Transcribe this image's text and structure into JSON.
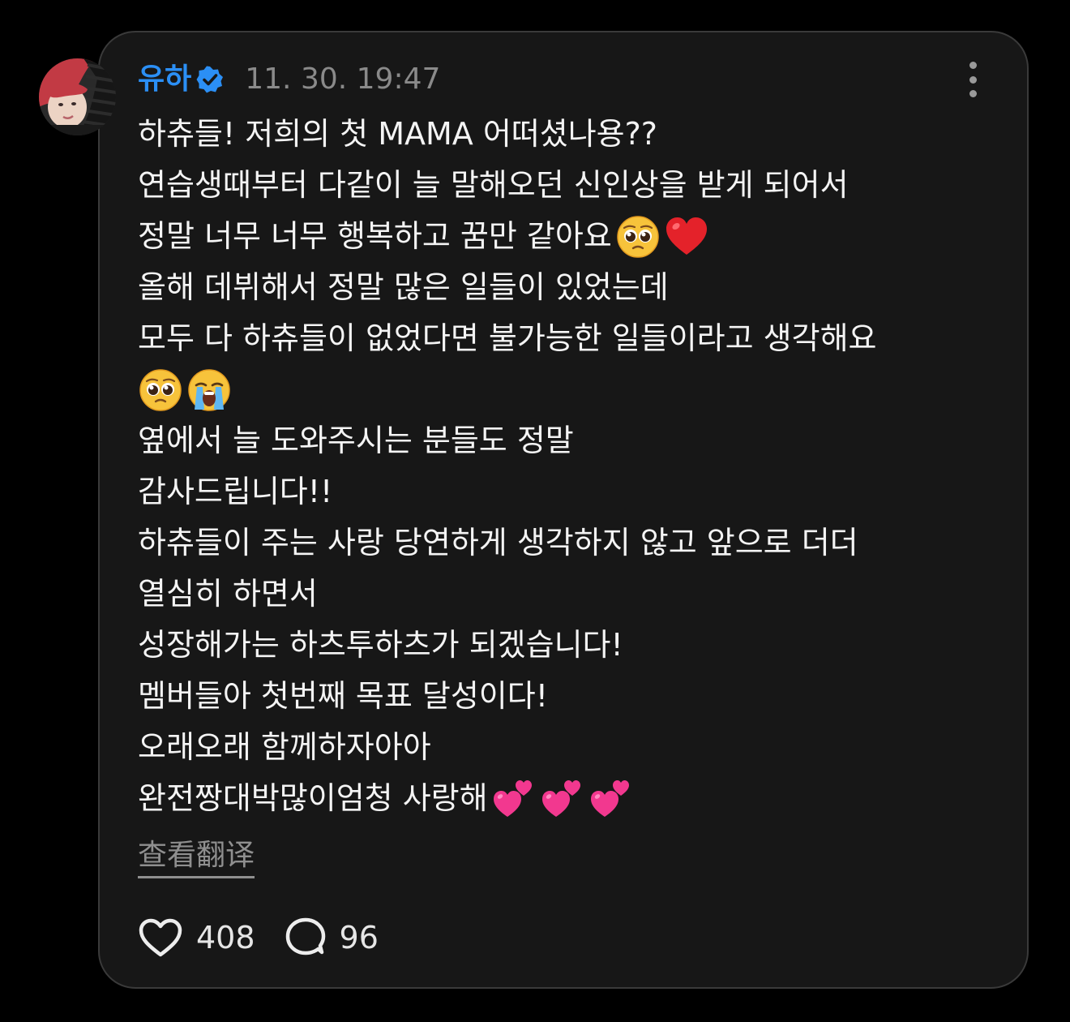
{
  "post": {
    "username": "유하",
    "timestamp": "11. 30. 19:47",
    "lines": [
      "하츄들! 저희의 첫 MAMA 어떠셨나용??",
      "연습생때부터 다같이 늘 말해오던 신인상을 받게 되어서",
      "정말 너무 너무 행복하고 꿈만 같아요",
      "올해 데뷔해서 정말 많은 일들이 있었는데",
      "모두 다 하츄들이 없었다면 불가능한 일들이라고 생각해요",
      "",
      "옆에서 늘 도와주시는 분들도 정말",
      "감사드립니다!!",
      "하츄들이 주는 사랑 당연하게 생각하지 않고 앞으로 더더",
      "열심히 하면서",
      "성장해가는 하츠투하츠가 되겠습니다!",
      "멤버들아 첫번째 목표 달성이다!",
      "오래오래 함께하자아아",
      "완전짱대박많이엄청 사랑해"
    ],
    "emojis": {
      "line3": [
        "pleading-face-emoji",
        "red-heart-emoji"
      ],
      "line6": [
        "pleading-face-emoji",
        "loudly-crying-face-emoji"
      ],
      "line14": [
        "two-hearts-emoji",
        "two-hearts-emoji",
        "two-hearts-emoji"
      ]
    },
    "translate_label": "查看翻译",
    "likes": "408",
    "replies": "96"
  },
  "icons": {
    "verified": "verified-badge-icon",
    "more": "more-options-icon",
    "like": "heart-outline-icon",
    "reply": "speech-bubble-icon"
  },
  "colors": {
    "background": "#000000",
    "card": "#171717",
    "card_border": "#3a3a3a",
    "username": "#2b8ff5",
    "text": "#f4f4f4",
    "muted": "#8a8a8a"
  }
}
